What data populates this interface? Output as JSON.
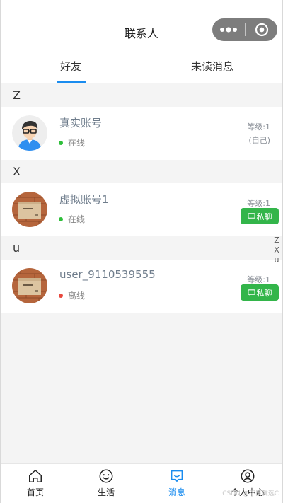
{
  "header": {
    "title": "联系人",
    "capsule_icons": [
      "more-icon",
      "target-icon"
    ]
  },
  "tabs": [
    {
      "label": "好友",
      "active": true
    },
    {
      "label": "未读消息",
      "active": false
    }
  ],
  "sections": [
    {
      "letter": "Z",
      "contacts": [
        {
          "name": "真实账号",
          "status": "在线",
          "online": true,
          "level": "等级:1",
          "note": "(自己)",
          "avatar": "cartoon-man-avatar"
        }
      ]
    },
    {
      "letter": "X",
      "contacts": [
        {
          "name": "虚拟账号1",
          "status": "在线",
          "online": true,
          "level": "等级:1",
          "button": "私聊",
          "avatar": "box-avatar"
        }
      ]
    },
    {
      "letter": "u",
      "contacts": [
        {
          "name": "user_9110539555",
          "status": "离线",
          "online": false,
          "level": "等级:1",
          "button": "私聊",
          "avatar": "box-avatar"
        }
      ]
    }
  ],
  "index_bar": [
    "Z",
    "X",
    "u"
  ],
  "tabbar": [
    {
      "label": "首页",
      "icon": "home-icon",
      "active": false
    },
    {
      "label": "生活",
      "icon": "smile-icon",
      "active": false
    },
    {
      "label": "消息",
      "icon": "message-icon",
      "active": true
    },
    {
      "label": "个人中心",
      "icon": "user-icon",
      "active": false
    }
  ],
  "watermark": "CSDN @不良就选C",
  "colors": {
    "accent": "#1a8cef",
    "online": "#2fbf3b",
    "offline": "#e8483e",
    "chat_button": "#33b54a"
  }
}
